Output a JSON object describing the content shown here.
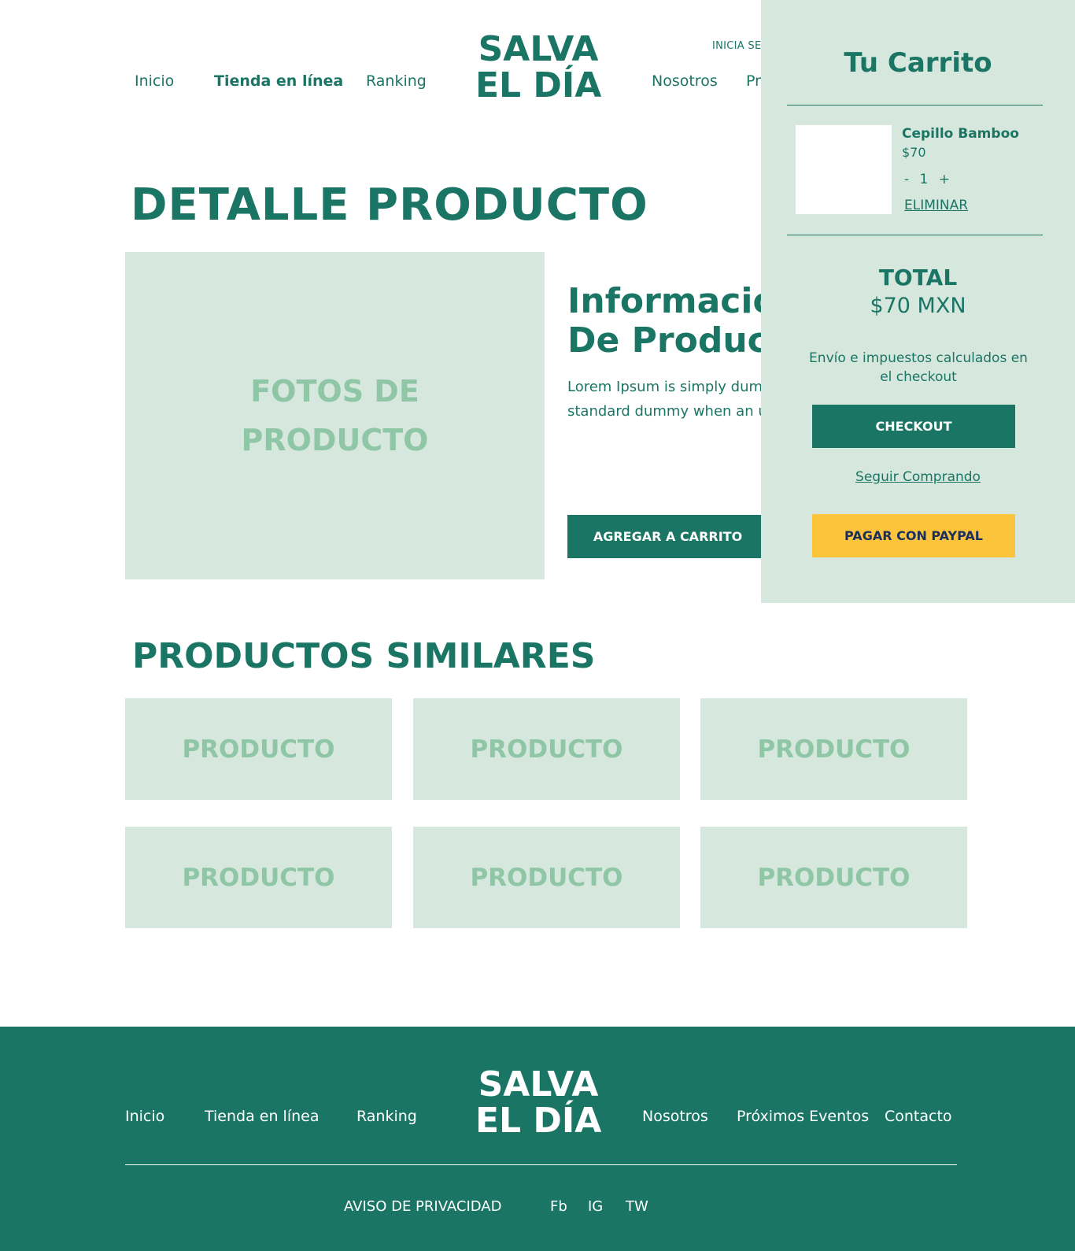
{
  "header": {
    "nav_left": [
      "Inicio",
      "Tienda en línea",
      "Ranking"
    ],
    "nav_right": [
      "Nosotros",
      "Pr"
    ],
    "logo_line1": "SALVA",
    "logo_line2": "EL DÍA",
    "login": "INICIA SES"
  },
  "main": {
    "page_title": "DETALLE PRODUCTO",
    "photo_label": "FOTOS DE PRODUCTO",
    "info_title_line1": "Informació",
    "info_title_line2": "De Product",
    "description": "Lorem Ipsum is simply dum typesetting industry. Lorem industry's standard dummy when an unknown printer t",
    "add_to_cart": "AGREGAR A CARRITO"
  },
  "similar": {
    "title": "PRODUCTOS SIMILARES",
    "products": [
      "PRODUCTO",
      "PRODUCTO",
      "PRODUCTO",
      "PRODUCTO",
      "PRODUCTO",
      "PRODUCTO"
    ]
  },
  "cart": {
    "title": "Tu Carrito",
    "item": {
      "name": "Cepillo Bamboo",
      "price": "$70",
      "minus": "-",
      "quantity": "1",
      "plus": "+",
      "remove": "ELIMINAR"
    },
    "total_label": "TOTAL",
    "total_value": "$70 MXN",
    "shipping_note": "Envío e impuestos calculados en el checkout",
    "checkout": "CHECKOUT",
    "continue": "Seguir Comprando",
    "paypal": "PAGAR CON PAYPAL"
  },
  "footer": {
    "nav_left": [
      "Inicio",
      "Tienda en línea",
      "Ranking"
    ],
    "nav_right": [
      "Nosotros",
      "Próximos Eventos",
      "Contacto"
    ],
    "logo_line1": "SALVA",
    "logo_line2": "EL DÍA",
    "privacy": "AVISO DE PRIVACIDAD",
    "social": [
      "Fb",
      "IG",
      "TW"
    ]
  },
  "colors": {
    "primary": "#1b7565",
    "light": "#d6e7dd",
    "placeholder_text": "#8ec6a6",
    "paypal": "#fbc43b",
    "paypal_text": "#1a2f5e"
  }
}
